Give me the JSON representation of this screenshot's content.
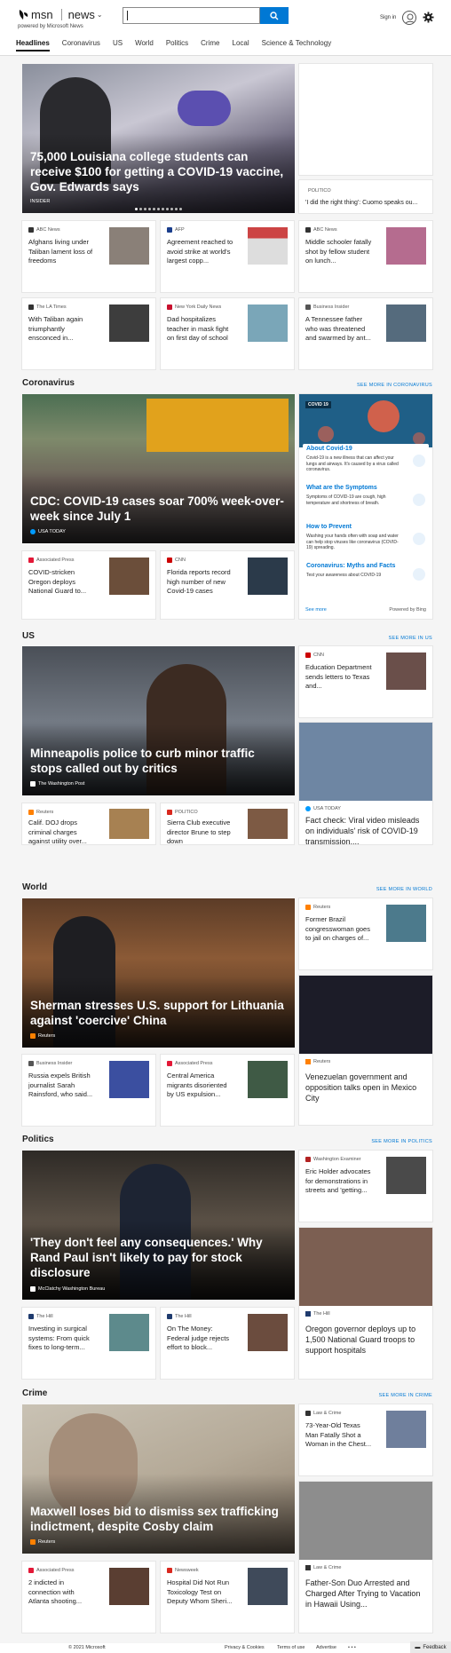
{
  "header": {
    "brand": "msn",
    "section": "news",
    "tagline": "powered by Microsoft News",
    "search_value": "",
    "signin": "Sign in"
  },
  "nav": [
    "Headlines",
    "Coronavirus",
    "US",
    "World",
    "Politics",
    "Crime",
    "Local",
    "Science & Technology"
  ],
  "headlines": {
    "hero": {
      "title": "75,000 Louisiana college students can receive $100 for getting a COVID-19 vaccine, Gov. Edwards says",
      "source": "INSIDER"
    },
    "side": {
      "source": "POLITICO",
      "title": "'I did the right thing': Cuomo speaks ou..."
    },
    "cards": [
      {
        "source": "ABC News",
        "title": "Afghans living under Taliban lament loss of freedoms"
      },
      {
        "source": "AFP",
        "title": "Agreement reached to avoid strike at world's largest copp..."
      },
      {
        "source": "ABC News",
        "title": "Middle schooler fatally shot by fellow student on lunch..."
      },
      {
        "source": "The LA Times",
        "title": "With Taliban again triumphantly ensconced in..."
      },
      {
        "source": "New York Daily News",
        "title": "Dad hospitalizes teacher in mask fight on first day of school"
      },
      {
        "source": "Business Insider",
        "title": "A Tennessee father who was threatened and swarmed by ant..."
      }
    ]
  },
  "coronavirus": {
    "title": "Coronavirus",
    "more": "SEE MORE IN CORONAVIRUS",
    "hero": {
      "title": "CDC: COVID-19 cases soar 700% week-over-week since July 1",
      "source": "USA TODAY"
    },
    "cards": [
      {
        "source": "Associated Press",
        "title": "COVID-stricken Oregon deploys National Guard to..."
      },
      {
        "source": "CNN",
        "title": "Florida reports record high number of new Covid-19 cases"
      }
    ],
    "widget": {
      "tag": "COVID 19",
      "items": [
        {
          "h": "About Covid-19",
          "d": "Covid-19 is a new illness that can affect your lungs and airways. It's caused by a virus called coronavirus."
        },
        {
          "h": "What are the Symptoms",
          "d": "Symptoms of COVID-19 are cough, high temperature and shortness of breath."
        },
        {
          "h": "How to Prevent",
          "d": "Washing your hands often with soap and water can help stop viruses like coronavirus (COVID-19) spreading."
        },
        {
          "h": "Coronavirus: Myths and Facts",
          "d": "Test your awareness about COVID-19"
        }
      ],
      "see_more": "See more",
      "powered": "Powered by Bing"
    }
  },
  "us": {
    "title": "US",
    "more": "SEE MORE IN US",
    "hero": {
      "title": "Minneapolis police to curb minor traffic stops called out by critics",
      "source": "The Washington Post"
    },
    "side1": {
      "source": "CNN",
      "title": "Education Department sends letters to Texas and..."
    },
    "side2": {
      "source": "USA TODAY",
      "title": "Fact check: Viral video misleads on individuals' risk of COVID-19 transmission,..."
    },
    "cards": [
      {
        "source": "Reuters",
        "title": "Calif. DOJ drops criminal charges against utility over..."
      },
      {
        "source": "POLITICO",
        "title": "Sierra Club executive director Brune to step down"
      }
    ]
  },
  "world": {
    "title": "World",
    "more": "SEE MORE IN WORLD",
    "hero": {
      "title": "Sherman stresses U.S. support for Lithuania against 'coercive' China",
      "source": "Reuters"
    },
    "side1": {
      "source": "Reuters",
      "title": "Former Brazil congresswoman goes to jail on charges of..."
    },
    "side2": {
      "source": "Reuters",
      "title": "Venezuelan government and opposition talks open in Mexico City"
    },
    "cards": [
      {
        "source": "Business Insider",
        "title": "Russia expels British journalist Sarah Rainsford, who said..."
      },
      {
        "source": "Associated Press",
        "title": "Central America migrants disoriented by US expulsion..."
      }
    ]
  },
  "politics": {
    "title": "Politics",
    "more": "SEE MORE IN POLITICS",
    "hero": {
      "title": "'They don't feel any consequences.' Why Rand Paul isn't likely to pay for stock disclosure",
      "source": "McClatchy Washington Bureau"
    },
    "side1": {
      "source": "Washington Examiner",
      "title": "Eric Holder advocates for demonstrations in streets and 'getting..."
    },
    "side2": {
      "source": "The Hill",
      "title": "Oregon governor deploys up to 1,500 National Guard troops to support hospitals"
    },
    "cards": [
      {
        "source": "The Hill",
        "title": "Investing in surgical systems: From quick fixes to long-term..."
      },
      {
        "source": "The Hill",
        "title": "On The Money: Federal judge rejects effort to block..."
      }
    ]
  },
  "crime": {
    "title": "Crime",
    "more": "SEE MORE IN CRIME",
    "hero": {
      "title": "Maxwell loses bid to dismiss sex trafficking indictment, despite Cosby claim",
      "source": "Reuters"
    },
    "side1": {
      "source": "Law & Crime",
      "title": "73-Year-Old Texas Man Fatally Shot a Woman in the Chest..."
    },
    "side2": {
      "source": "Law & Crime",
      "title": "Father-Son Duo Arrested and Charged After Trying to Vacation in Hawaii Using..."
    },
    "cards": [
      {
        "source": "Associated Press",
        "title": "2 indicted in connection with Atlanta shooting..."
      },
      {
        "source": "Newsweek",
        "title": "Hospital Did Not Run Toxicology Test on Deputy Whom Sheri..."
      }
    ]
  },
  "footer": {
    "copyright": "© 2021 Microsoft",
    "privacy": "Privacy & Cookies",
    "terms": "Terms of use",
    "advertise": "Advertise",
    "more": "• • •",
    "feedback": "Feedback"
  }
}
